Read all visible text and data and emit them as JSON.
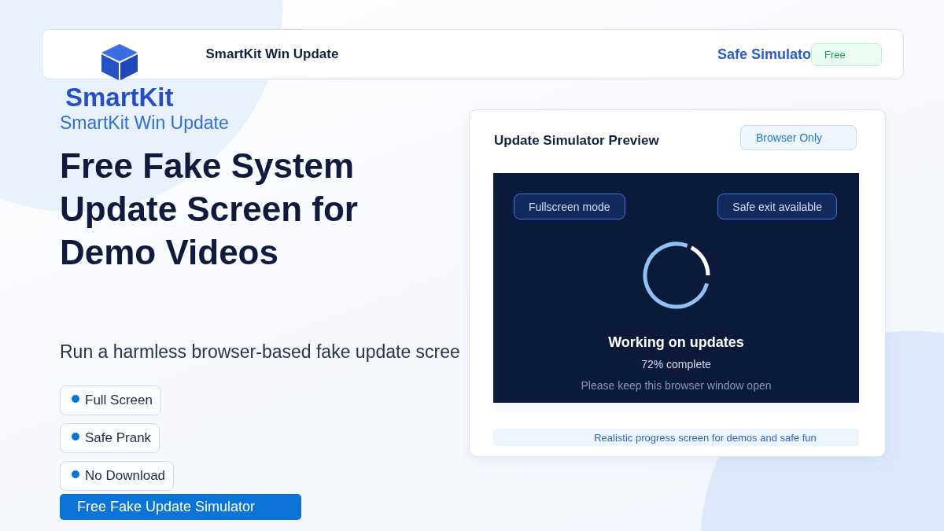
{
  "header": {
    "logo_text": "SmartKit",
    "title": "SmartKit Win Update",
    "tagline": "Safe Simulato",
    "badge": "Free"
  },
  "hero": {
    "eyebrow": "SmartKit Win Update",
    "headline": "Free Fake System Update Screen for Demo Videos",
    "subtitle": "Run a harmless browser-based fake update scree",
    "features": [
      "Full Screen",
      "Safe Prank",
      "No Download"
    ],
    "cta": "Free Fake Update Simulator"
  },
  "preview": {
    "title": "Update Simulator Preview",
    "badge": "Browser Only",
    "screen": {
      "pills": [
        "Fullscreen mode",
        "Safe exit available"
      ],
      "status": "Working on updates",
      "progress_text": "72% complete",
      "hint": "Please keep this browser window open"
    },
    "caption": "Realistic progress screen for demos and safe fun"
  }
}
